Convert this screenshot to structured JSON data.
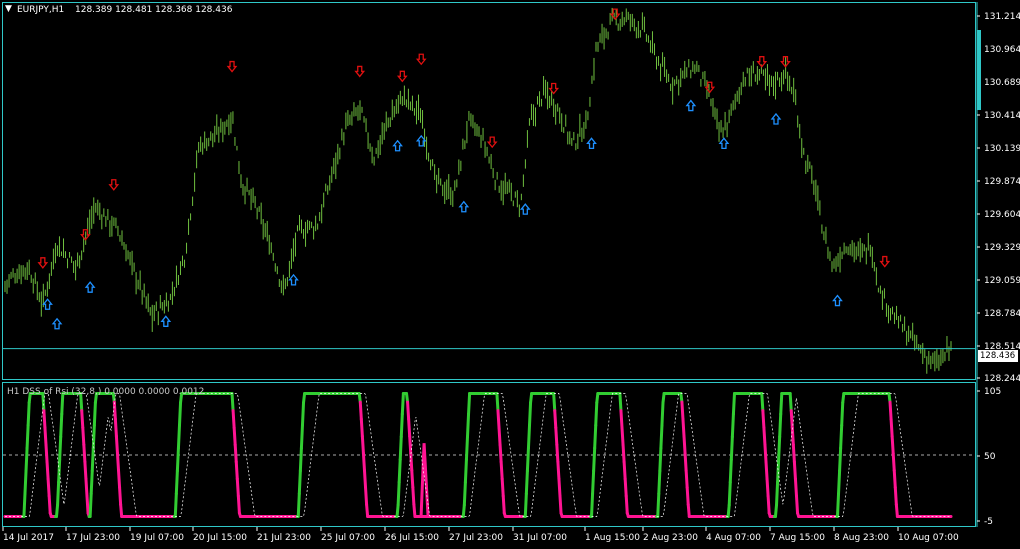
{
  "window": {
    "title": "EURJPY,H1",
    "ohlc": "128.389 128.481 128.368 128.436"
  },
  "current_price": "128.436",
  "price_axis": [
    "131.214",
    "130.964",
    "130.689",
    "130.414",
    "130.139",
    "129.874",
    "129.604",
    "129.329",
    "129.059",
    "128.784",
    "128.514",
    "128.244"
  ],
  "price_range": [
    128.2,
    131.32
  ],
  "indicator": {
    "title": "H1 DSS of Rsi (32,8,) 0.0000 0.0000 0.0012",
    "axis": [
      "105",
      "50",
      "-5"
    ],
    "levels": {
      "top": 105,
      "mid": 50,
      "bottom": -5
    }
  },
  "time_axis": [
    "14 Jul 2017",
    "17 Jul 23:00",
    "19 Jul 07:00",
    "20 Jul 15:00",
    "21 Jul 23:00",
    "25 Jul 07:00",
    "26 Jul 15:00",
    "27 Jul 23:00",
    "31 Jul 07:00",
    "1 Aug 15:00",
    "2 Aug 23:00",
    "4 Aug 07:00",
    "7 Aug 15:00",
    "8 Aug 23:00",
    "10 Aug 07:00"
  ],
  "colors": {
    "background": "#000000",
    "frame": "#2fc8c8",
    "bars": "#6fbf3f",
    "up_arrow": "#1e90ff",
    "down_arrow": "#e01010",
    "dss_green": "#32cd32",
    "dss_pink": "#ff1493",
    "signal": "#ffffff",
    "axis_text": "#ffffff",
    "price_box_bg": "#ffffff"
  },
  "icons": {
    "window_menu": "triangle-down-icon",
    "buy_signal": "up-arrow-icon",
    "sell_signal": "down-arrow-icon"
  },
  "chart_data": {
    "type": "bar",
    "symbol": "EURJPY",
    "timeframe": "H1",
    "ylim": [
      128.244,
      131.214
    ],
    "close_path": [
      [
        0,
        128.95
      ],
      [
        0.01,
        129.05
      ],
      [
        0.025,
        129.1
      ],
      [
        0.04,
        128.8
      ],
      [
        0.055,
        129.3
      ],
      [
        0.075,
        129.1
      ],
      [
        0.095,
        129.6
      ],
      [
        0.12,
        129.4
      ],
      [
        0.14,
        129.0
      ],
      [
        0.155,
        128.7
      ],
      [
        0.175,
        128.85
      ],
      [
        0.19,
        129.2
      ],
      [
        0.205,
        130.1
      ],
      [
        0.225,
        130.2
      ],
      [
        0.24,
        130.35
      ],
      [
        0.25,
        129.8
      ],
      [
        0.265,
        129.6
      ],
      [
        0.28,
        129.3
      ],
      [
        0.295,
        128.9
      ],
      [
        0.31,
        129.4
      ],
      [
        0.33,
        129.45
      ],
      [
        0.345,
        129.85
      ],
      [
        0.36,
        130.25
      ],
      [
        0.375,
        130.4
      ],
      [
        0.39,
        130.0
      ],
      [
        0.405,
        130.3
      ],
      [
        0.42,
        130.5
      ],
      [
        0.44,
        130.35
      ],
      [
        0.455,
        129.8
      ],
      [
        0.475,
        129.7
      ],
      [
        0.49,
        130.3
      ],
      [
        0.505,
        130.15
      ],
      [
        0.52,
        129.8
      ],
      [
        0.535,
        129.7
      ],
      [
        0.545,
        129.6
      ],
      [
        0.555,
        130.3
      ],
      [
        0.57,
        130.55
      ],
      [
        0.585,
        130.4
      ],
      [
        0.6,
        130.1
      ],
      [
        0.615,
        130.3
      ],
      [
        0.625,
        130.9
      ],
      [
        0.64,
        131.1
      ],
      [
        0.655,
        131.15
      ],
      [
        0.675,
        131.05
      ],
      [
        0.69,
        130.8
      ],
      [
        0.705,
        130.6
      ],
      [
        0.72,
        130.7
      ],
      [
        0.73,
        130.75
      ],
      [
        0.745,
        130.5
      ],
      [
        0.755,
        130.2
      ],
      [
        0.765,
        130.3
      ],
      [
        0.78,
        130.65
      ],
      [
        0.795,
        130.7
      ],
      [
        0.81,
        130.6
      ],
      [
        0.825,
        130.7
      ],
      [
        0.835,
        130.5
      ],
      [
        0.845,
        130.0
      ],
      [
        0.855,
        129.8
      ],
      [
        0.865,
        129.4
      ],
      [
        0.875,
        129.1
      ],
      [
        0.89,
        129.3
      ],
      [
        0.905,
        129.2
      ],
      [
        0.915,
        129.3
      ],
      [
        0.925,
        128.9
      ],
      [
        0.94,
        128.7
      ],
      [
        0.955,
        128.55
      ],
      [
        0.97,
        128.4
      ],
      [
        0.985,
        128.3
      ],
      [
        1.0,
        128.44
      ]
    ],
    "buy_signals": [
      [
        0.045,
        128.8
      ],
      [
        0.055,
        128.64
      ],
      [
        0.09,
        128.94
      ],
      [
        0.17,
        128.66
      ],
      [
        0.305,
        129.0
      ],
      [
        0.415,
        130.1
      ],
      [
        0.44,
        130.14
      ],
      [
        0.485,
        129.6
      ],
      [
        0.55,
        129.58
      ],
      [
        0.62,
        130.12
      ],
      [
        0.725,
        130.43
      ],
      [
        0.76,
        130.12
      ],
      [
        0.815,
        130.32
      ],
      [
        0.88,
        128.83
      ]
    ],
    "sell_signals": [
      [
        0.04,
        129.14
      ],
      [
        0.085,
        129.37
      ],
      [
        0.115,
        129.78
      ],
      [
        0.24,
        130.75
      ],
      [
        0.375,
        130.71
      ],
      [
        0.42,
        130.67
      ],
      [
        0.44,
        130.81
      ],
      [
        0.515,
        130.13
      ],
      [
        0.58,
        130.57
      ],
      [
        0.645,
        131.18
      ],
      [
        0.745,
        130.58
      ],
      [
        0.8,
        130.79
      ],
      [
        0.825,
        130.79
      ],
      [
        0.93,
        129.15
      ]
    ],
    "indicator_series": {
      "name": "DSS of Rsi",
      "ylim": [
        -5,
        105
      ],
      "cycles": [
        [
          0.02,
          0.04
        ],
        [
          0.055,
          0.08
        ],
        [
          0.09,
          0.1
        ],
        [
          0.095,
          0.115
        ],
        [
          0.18,
          0.24
        ],
        [
          0.31,
          0.375
        ],
        [
          0.415,
          0.425
        ],
        [
          0.485,
          0.52
        ],
        [
          0.55,
          0.58
        ],
        [
          0.62,
          0.65
        ],
        [
          0.69,
          0.715
        ],
        [
          0.765,
          0.8
        ],
        [
          0.815,
          0.83
        ],
        [
          0.88,
          0.935
        ]
      ],
      "spike": [
        0.443,
        0.6
      ]
    }
  }
}
